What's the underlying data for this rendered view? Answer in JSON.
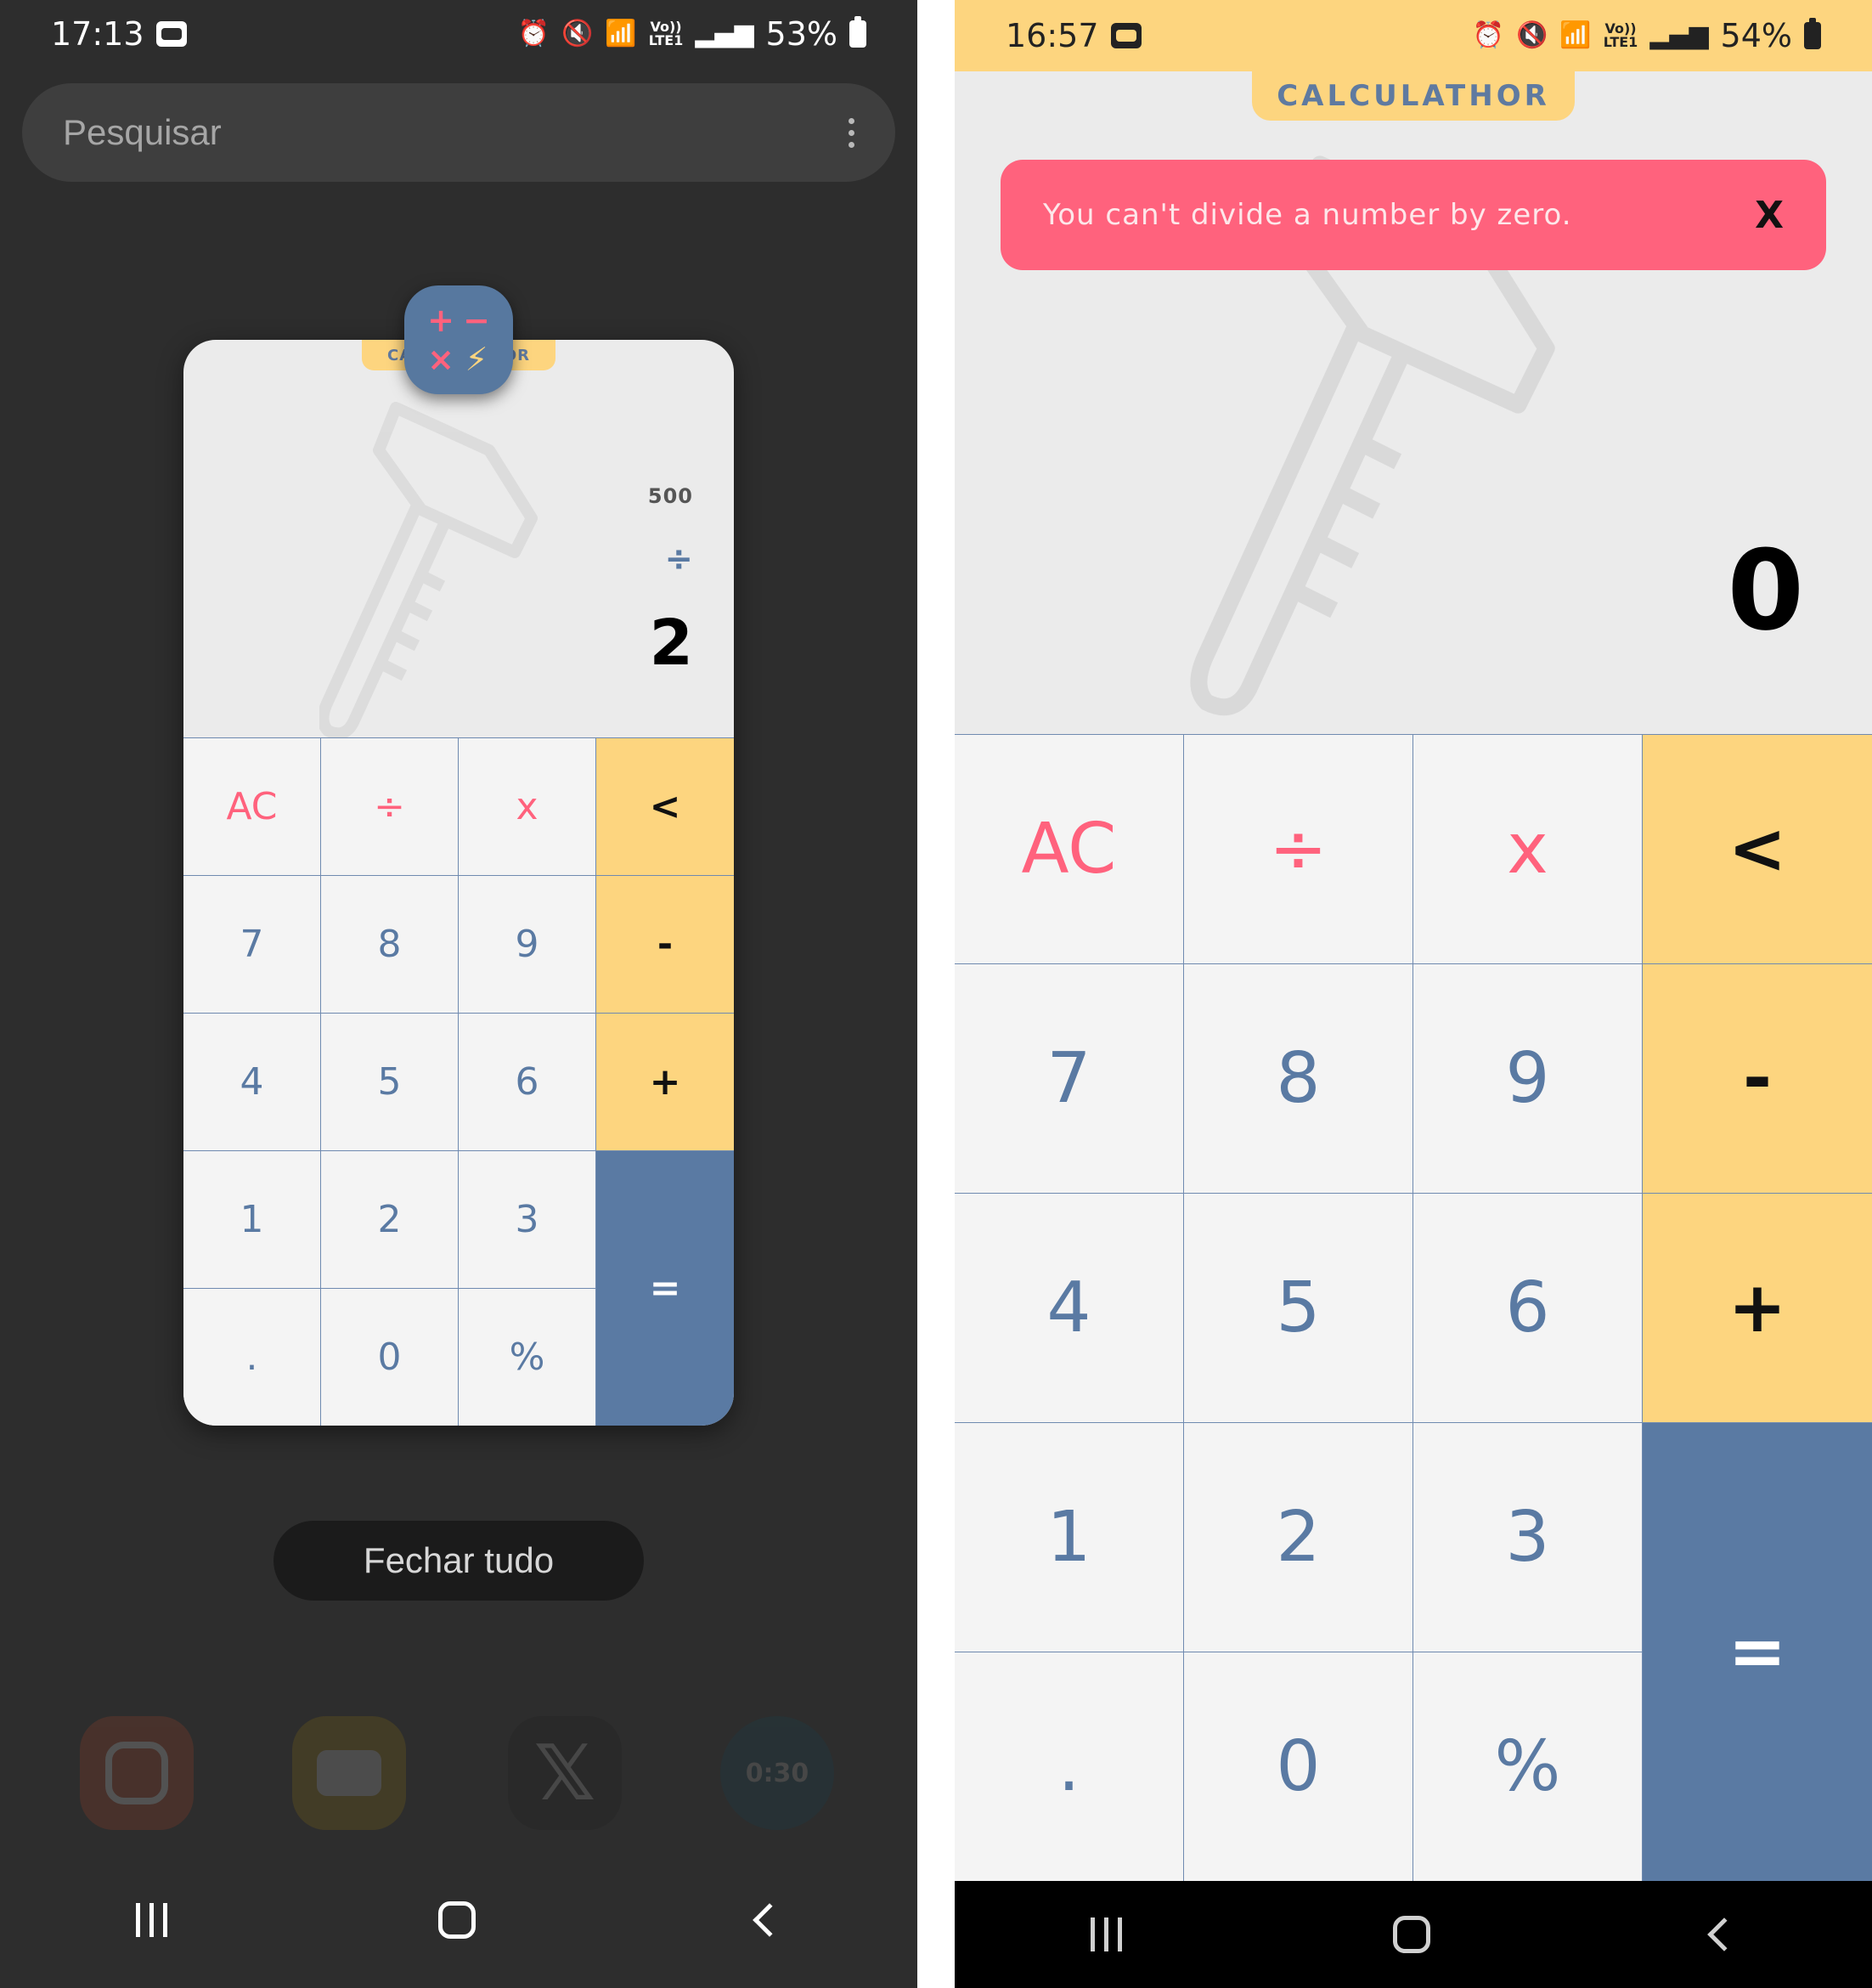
{
  "left_phone": {
    "status_bar": {
      "time": "17:13",
      "battery": "53%",
      "network": "Vo))\nLTE1"
    },
    "search": {
      "placeholder": "Pesquisar"
    },
    "recent_card": {
      "app_tab_label_start": "CA",
      "app_tab_label_end": "OR",
      "display": {
        "previous": "500",
        "operator": "÷",
        "current": "2"
      },
      "keys": [
        "AC",
        "÷",
        "x",
        "<",
        "7",
        "8",
        "9",
        "-",
        "4",
        "5",
        "6",
        "+",
        "1",
        "2",
        "3",
        "=",
        ".",
        "0",
        "%"
      ]
    },
    "app_icon_symbols": [
      "+",
      "−",
      "×",
      "⚡"
    ],
    "close_all_label": "Fechar tudo",
    "dock_apps": [
      "instagram-icon",
      "youtube-icon",
      "x-icon",
      "timer-icon"
    ],
    "dock_timer_label": "0:30"
  },
  "right_phone": {
    "status_bar": {
      "time": "16:57",
      "battery": "54%",
      "network": "Vo))\nLTE1"
    },
    "app_title": "CALCULATHOR",
    "toast": {
      "message": "You can't divide a number by zero.",
      "close": "X"
    },
    "display": {
      "current": "0"
    },
    "keys": [
      "AC",
      "÷",
      "x",
      "<",
      "7",
      "8",
      "9",
      "-",
      "4",
      "5",
      "6",
      "+",
      "1",
      "2",
      "3",
      "=",
      ".",
      "0",
      "%"
    ]
  },
  "colors": {
    "yellow": "#fdd57f",
    "blue": "#5a7aa3",
    "red": "#ff627d",
    "key_bg": "#f4f4f4",
    "display_bg": "#ebebeb",
    "recents_bg": "#2d2d2d"
  }
}
